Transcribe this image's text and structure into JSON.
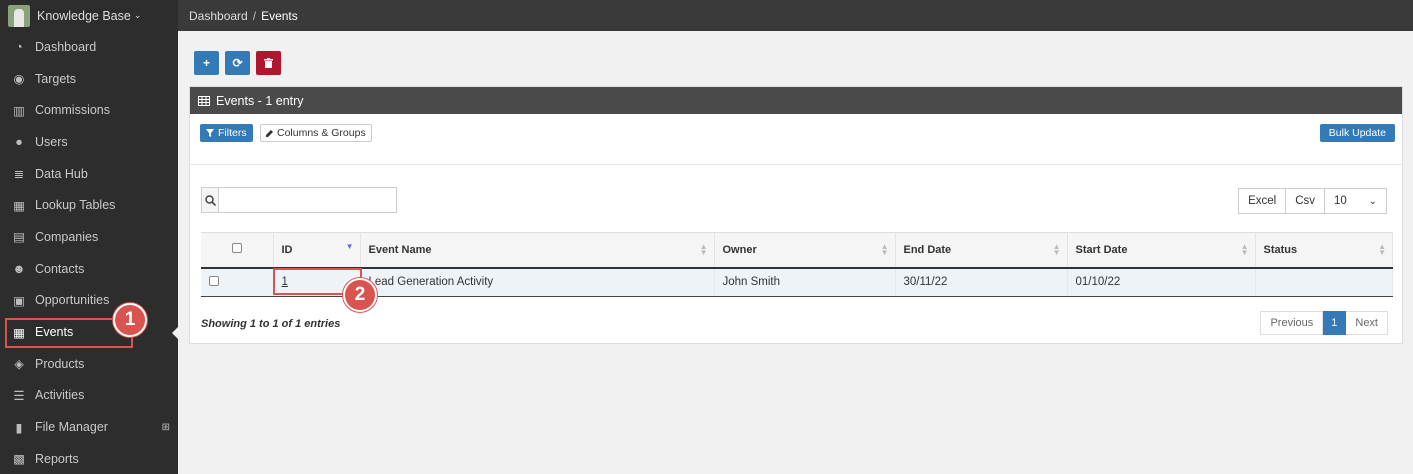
{
  "brand": {
    "name": "Knowledge Base",
    "caret": "⌄"
  },
  "sidebar": {
    "items": [
      {
        "label": "Dashboard",
        "icon": "dashboard-icon",
        "glyph": "◔"
      },
      {
        "label": "Targets",
        "icon": "target-icon",
        "glyph": "◉"
      },
      {
        "label": "Commissions",
        "icon": "bar-chart-icon",
        "glyph": "▥"
      },
      {
        "label": "Users",
        "icon": "user-icon",
        "glyph": "●"
      },
      {
        "label": "Data Hub",
        "icon": "database-icon",
        "glyph": "≣"
      },
      {
        "label": "Lookup Tables",
        "icon": "table-icon",
        "glyph": "▦"
      },
      {
        "label": "Companies",
        "icon": "building-icon",
        "glyph": "▤"
      },
      {
        "label": "Contacts",
        "icon": "users-icon",
        "glyph": "☻"
      },
      {
        "label": "Opportunities",
        "icon": "money-icon",
        "glyph": "▣"
      },
      {
        "label": "Events",
        "icon": "calendar-icon",
        "glyph": "▦",
        "active": true
      },
      {
        "label": "Products",
        "icon": "cube-icon",
        "glyph": "◈"
      },
      {
        "label": "Activities",
        "icon": "tasks-icon",
        "glyph": "☰"
      },
      {
        "label": "File Manager",
        "icon": "file-icon",
        "glyph": "▮",
        "plus": "⊞"
      },
      {
        "label": "Reports",
        "icon": "reports-icon",
        "glyph": "▩"
      }
    ]
  },
  "breadcrumb": {
    "parent": "Dashboard",
    "separator": "/",
    "current": "Events"
  },
  "toolbar": {
    "add": "+",
    "refresh": "⟳",
    "delete": "🗑"
  },
  "panel": {
    "title": "Events - 1 entry",
    "filters_label": "Filters",
    "columns_label": "Columns & Groups",
    "bulk_update_label": "Bulk Update",
    "search_placeholder": "",
    "export": {
      "excel": "Excel",
      "csv": "Csv",
      "page_size": "10"
    }
  },
  "table": {
    "columns": [
      "ID",
      "Event Name",
      "Owner",
      "End Date",
      "Start Date",
      "Status"
    ],
    "rows": [
      {
        "id": "1",
        "event_name": "Lead Generation Activity",
        "owner": "John Smith",
        "end_date": "30/11/22",
        "start_date": "01/10/22",
        "status": ""
      }
    ]
  },
  "footer": {
    "showing": "Showing 1 to 1 of 1 entries",
    "previous": "Previous",
    "page": "1",
    "next": "Next"
  },
  "markers": {
    "first": "1",
    "second": "2"
  },
  "colors": {
    "primary": "#337ab7",
    "danger": "#b0172e",
    "highlight": "#d9534f",
    "sidebar": "#2d2d2d"
  }
}
